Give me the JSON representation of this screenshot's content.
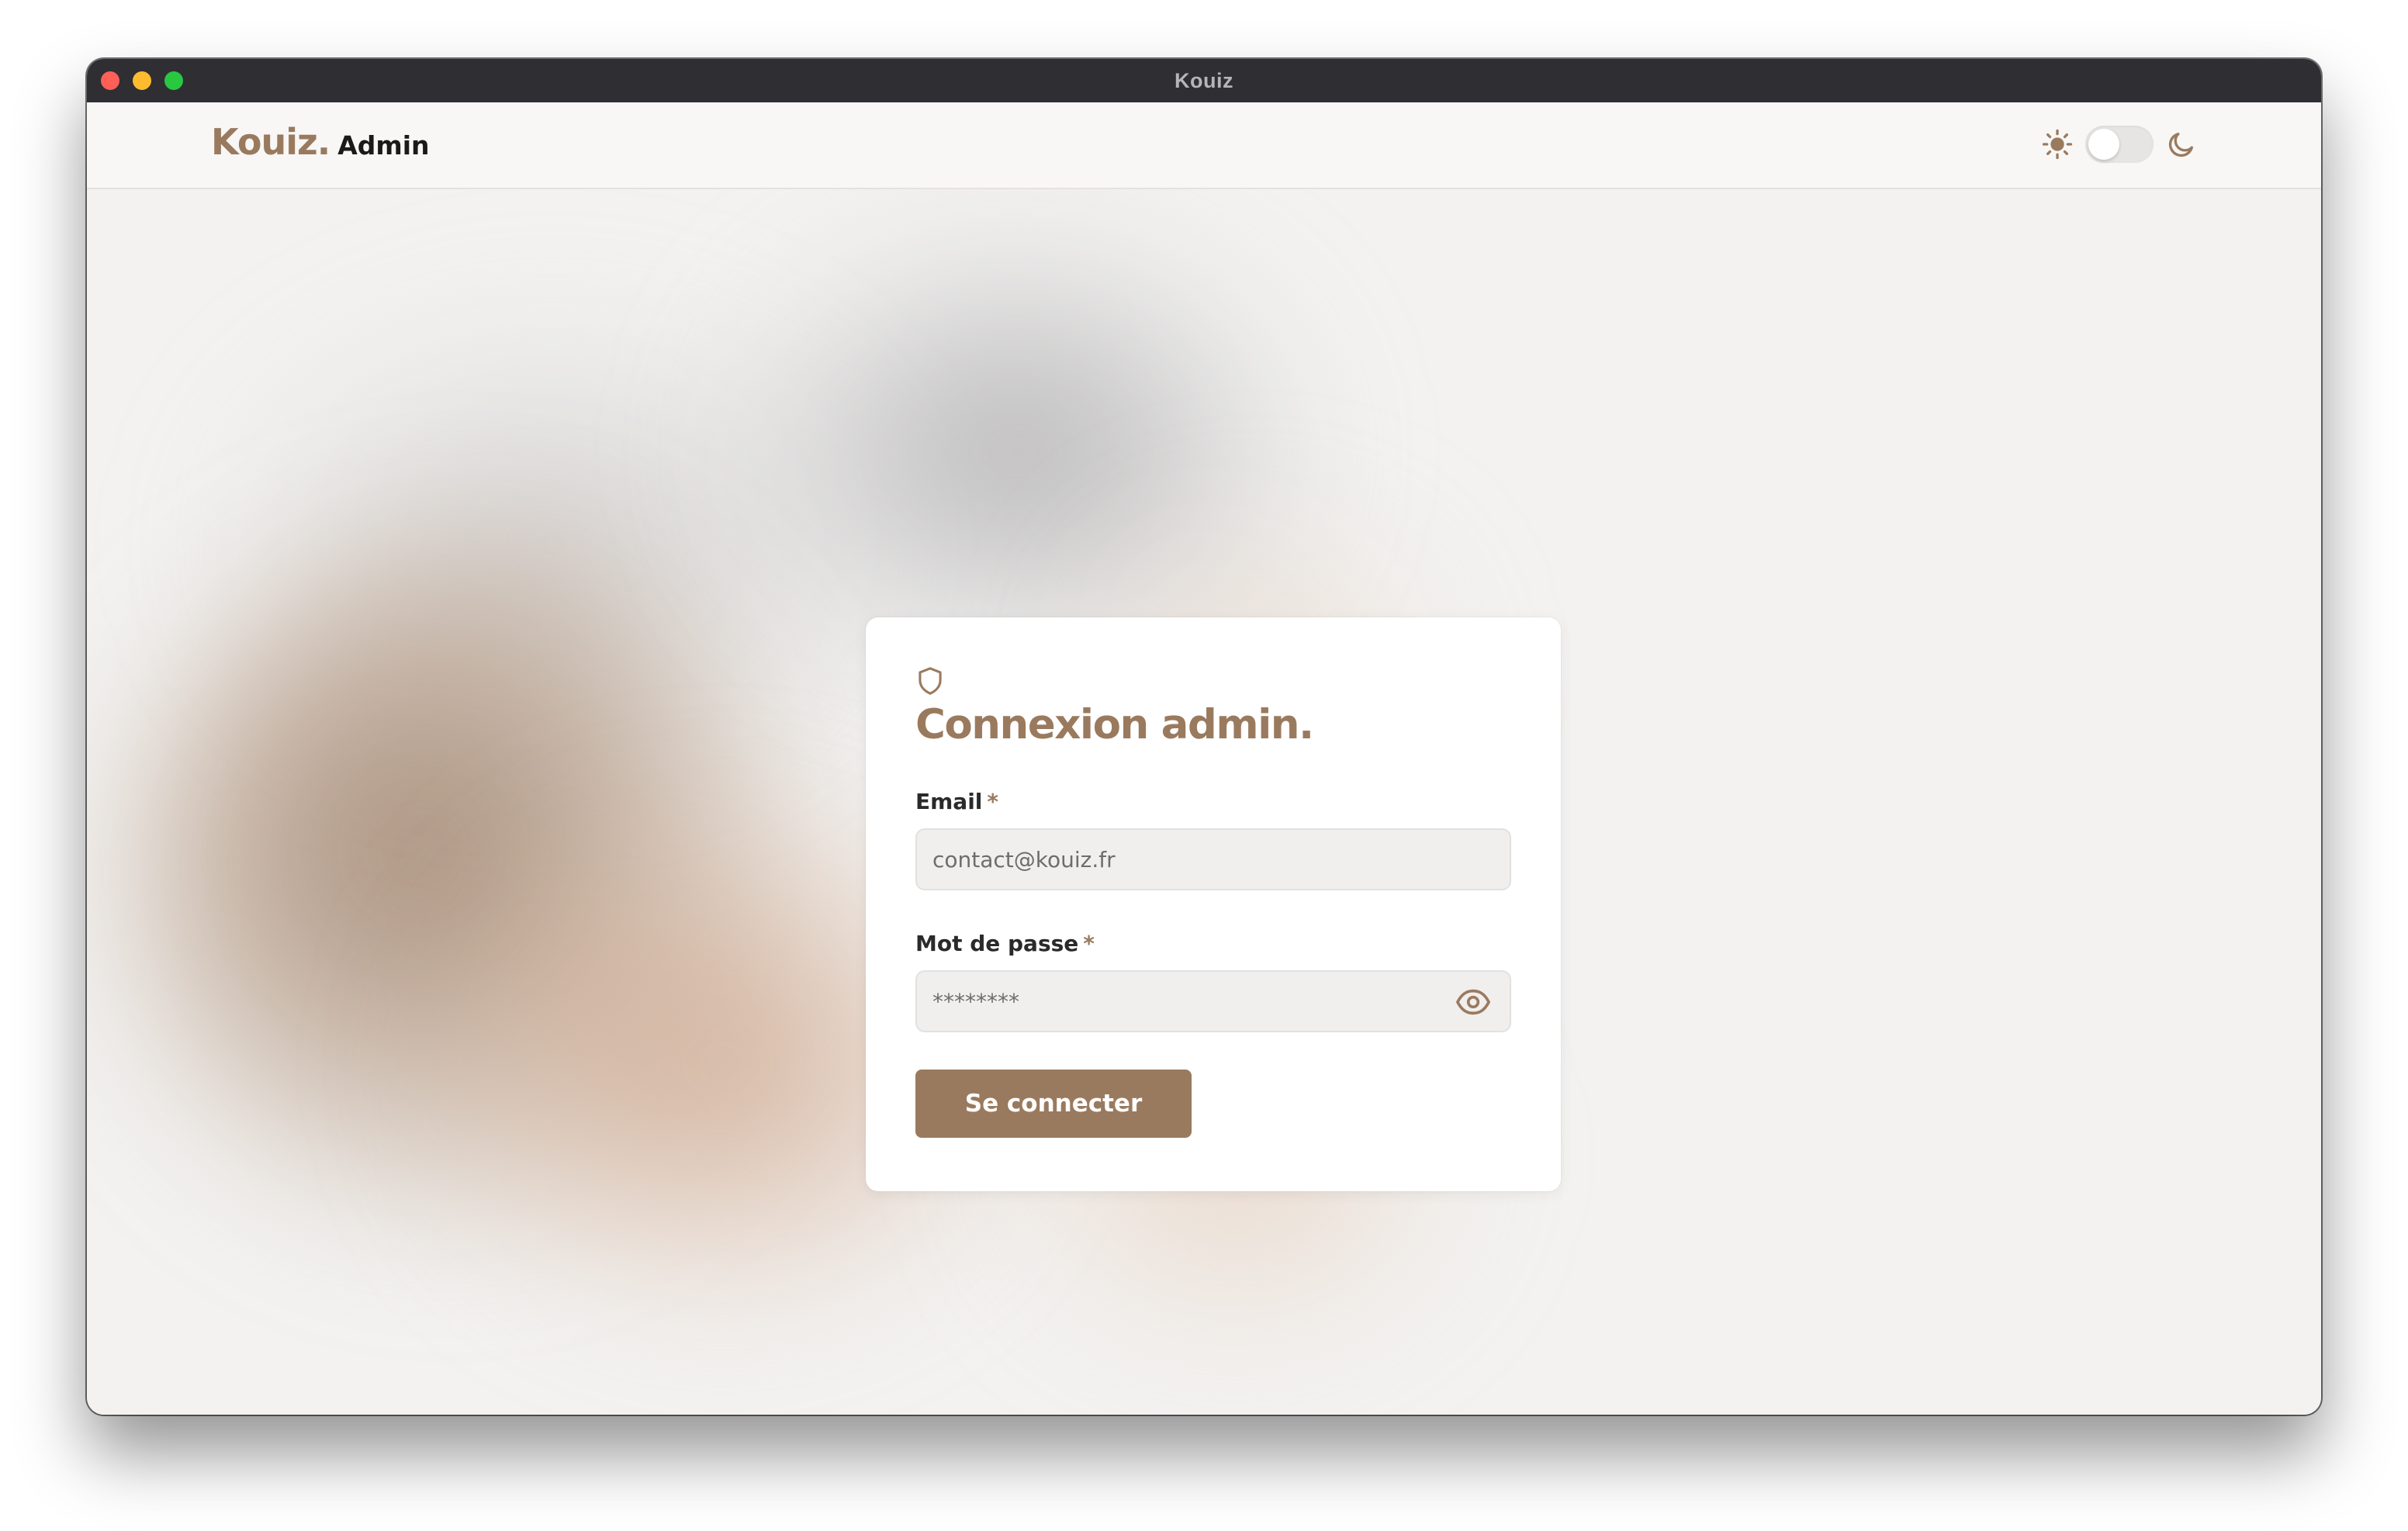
{
  "window": {
    "title": "Kouiz"
  },
  "header": {
    "logo_main": "Kouiz.",
    "logo_sub": "Admin",
    "theme_icons": [
      "sun-icon",
      "moon-icon"
    ],
    "theme_toggle_state": "off"
  },
  "login": {
    "title": "Connexion admin.",
    "icon": "shield-icon",
    "email_label": "Email",
    "email_required_mark": "*",
    "email_placeholder": "contact@kouiz.fr",
    "password_label": "Mot de passe",
    "password_required_mark": "*",
    "password_placeholder": "********",
    "password_toggle_icon": "eye-icon",
    "submit_label": "Se connecter"
  },
  "colors": {
    "accent": "#9a7a5e",
    "titlebar": "#2f2e33",
    "background": "#f3f2f1",
    "card": "#ffffff"
  }
}
